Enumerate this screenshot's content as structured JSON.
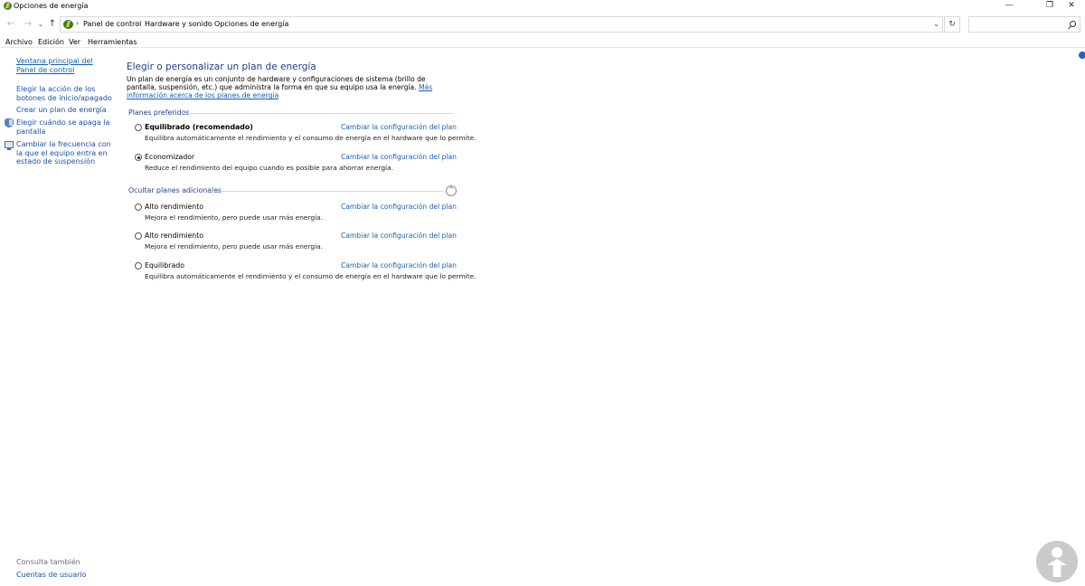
{
  "window": {
    "title": "Opciones de energía",
    "controls": {
      "minimize": "—",
      "restore": "❐",
      "close": "✕"
    }
  },
  "nav": {
    "back_icon": "←",
    "forward_icon": "→",
    "recent_icon": "⌄",
    "up_icon": "↑",
    "address_icon": "power-options-icon",
    "breadcrumbs": [
      "Panel de control",
      "Hardware y sonido",
      "Opciones de energía"
    ],
    "separator": "›",
    "dropdown_icon": "⌄",
    "refresh_icon": "↻",
    "search_placeholder": ""
  },
  "menu": [
    "Archivo",
    "Edición",
    "Ver",
    "Herramientas"
  ],
  "sidebar": {
    "home_link": "Ventana principal del Panel de control",
    "links": [
      "Elegir la acción de los botones de inicio/apagado",
      "Crear un plan de energía",
      "Elegir cuándo se apaga la pantalla",
      "Cambiar la frecuencia con la que el equipo entra en estado de suspensión"
    ],
    "see_also_label": "Consulta también",
    "see_also_links": [
      "Cuentas de usuario"
    ]
  },
  "main": {
    "title": "Elegir o personalizar un plan de energía",
    "intro_text": "Un plan de energía es un conjunto de hardware y configuraciones de sistema (brillo de pantalla, suspensión, etc.) que administra la forma en que su equipo usa la energía.",
    "intro_link": "Más información acerca de los planes de energía",
    "preferred_heading": "Planes preferidos",
    "additional_heading": "Ocultar planes adicionales",
    "collapse_icon": "^",
    "preferred_plans": [
      {
        "name": "Equilibrado (recomendado)",
        "description": "Equilibra automáticamente el rendimiento y el consumo de energía en el hardware que lo permite.",
        "link": "Cambiar la configuración del plan",
        "selected": false,
        "bold": true
      },
      {
        "name": "Economizador",
        "description": "Reduce el rendimiento del equipo cuando es posible para ahorrar energía.",
        "link": "Cambiar la configuración del plan",
        "selected": true,
        "bold": false
      }
    ],
    "additional_plans": [
      {
        "name": "Alto rendimiento",
        "description": "Mejora el rendimiento, pero puede usar más energía.",
        "link": "Cambiar la configuración del plan",
        "selected": false
      },
      {
        "name": "Alto rendimiento",
        "description": "Mejora el rendimiento, pero puede usar más energía.",
        "link": "Cambiar la configuración del plan",
        "selected": false
      },
      {
        "name": "Equilibrado",
        "description": "Equilibra automáticamente el rendimiento y el consumo de energía en el hardware que lo permite.",
        "link": "Cambiar la configuración del plan",
        "selected": false
      }
    ]
  },
  "colors": {
    "link": "#1a5fb4",
    "heading": "#1e3f8c",
    "accent": "#1e63c6"
  }
}
